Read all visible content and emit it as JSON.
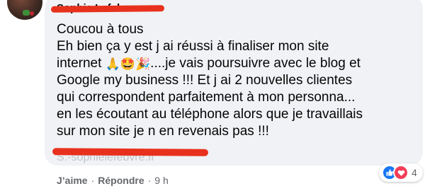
{
  "comment": {
    "author": "Sophie Lefebvre",
    "signature": "S.-sophielefebvre.fr",
    "lines": [
      {
        "text": "Coucou à tous"
      },
      {
        "text": "Eh bien ça y est j ai réussi à finaliser mon site"
      },
      {
        "before": "internet ",
        "emojis": [
          "🙏",
          "🤩",
          "🎉"
        ],
        "after": "....je vais poursuivre avec le blog et"
      },
      {
        "text": "Google my business !!! Et j ai 2 nouvelles clientes"
      },
      {
        "text": "qui correspondent parfaitement à mon personna..."
      },
      {
        "text": "en les écoutant au téléphone alors que je travaillais"
      },
      {
        "text": "sur mon site je n en revenais pas !!!"
      }
    ]
  },
  "actions": {
    "like": "J’aime",
    "separator": "·",
    "reply": "Répondre",
    "time": "9 h"
  },
  "reactions": {
    "icons": [
      "like-icon",
      "love-icon"
    ],
    "count": "4",
    "colors": {
      "like": "#1877f2",
      "love": "#f33e58"
    }
  },
  "redaction_color": "#e8311c"
}
